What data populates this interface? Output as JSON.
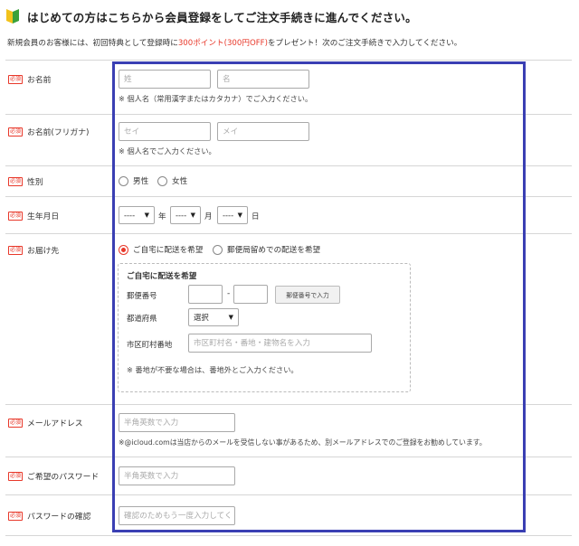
{
  "header": {
    "title": "はじめての方はこちらから会員登録をしてご注文手続きに進んでください。",
    "intro_before": "新規会員のお客様には、初回特典として登録時に",
    "intro_highlight": "300ポイント(300円OFF)",
    "intro_after": "をプレゼント！次のご注文手続きで入力してください。"
  },
  "required_badge": "必須",
  "name": {
    "label": "お名前",
    "last_placeholder": "姓",
    "first_placeholder": "名",
    "note": "※ 個人名（常用漢字またはカタカナ）でご入力ください。"
  },
  "furigana": {
    "label": "お名前(フリガナ)",
    "last_placeholder": "セイ",
    "first_placeholder": "メイ",
    "note": "※ 個人名でご入力ください。"
  },
  "gender": {
    "label": "性別",
    "options": [
      "男性",
      "女性"
    ]
  },
  "birthdate": {
    "label": "生年月日",
    "year_value": "----",
    "month_value": "----",
    "day_value": "----",
    "year_unit": "年",
    "month_unit": "月",
    "day_unit": "日"
  },
  "delivery": {
    "label": "お届け先",
    "option_home": "ご自宅に配送を希望",
    "option_post": "郵便局留めでの配送を希望",
    "home_title": "ご自宅に配送を希望",
    "postal_label": "郵便番号",
    "postal_button": "郵便番号で入力",
    "prefecture_label": "都道府県",
    "prefecture_value": "選択",
    "city_label": "市区町村番地",
    "city_placeholder": "市区町村名・番地・建物名を入力",
    "note": "※ 番地が不要な場合は、番地外とご入力ください。"
  },
  "email": {
    "label": "メールアドレス",
    "placeholder": "半角英数で入力",
    "note": "※@icloud.comは当店からのメールを受信しない事があるため、別メールアドレスでのご登録をお勧めしています。"
  },
  "password": {
    "label": "ご希望のパスワード",
    "placeholder": "半角英数で入力"
  },
  "password_confirm": {
    "label": "パスワードの確認",
    "placeholder": "確認のためもう一度入力してください"
  },
  "colors": {
    "accent_red": "#e8382a",
    "highlight_border": "#3a3fb3",
    "leaf_green": "#3aa13a",
    "leaf_yellow": "#f2c21b"
  }
}
